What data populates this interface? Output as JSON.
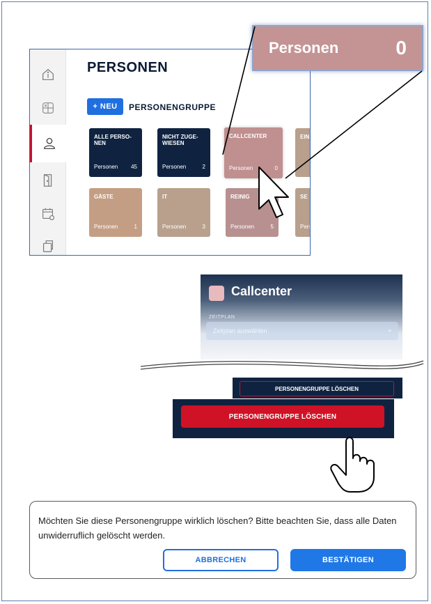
{
  "app": {
    "title": "PERSONEN",
    "new_button": "+ NEU",
    "group_label": "PERSONENGRUPPE",
    "sidebar": [
      {
        "icon": "info-icon"
      },
      {
        "icon": "calculator-icon"
      },
      {
        "icon": "user-icon",
        "active": true
      },
      {
        "icon": "door-icon"
      },
      {
        "icon": "calendar-icon"
      },
      {
        "icon": "copy-icon"
      }
    ],
    "tiles_row1": [
      {
        "name": "ALLE PERSO-\nNEN",
        "foot_label": "Personen",
        "count": "45"
      },
      {
        "name": "NICHT ZUGE-\nWIESEN",
        "foot_label": "Personen",
        "count": "2"
      },
      {
        "name": "CALLCENTER",
        "foot_label": "Personen",
        "count": "0"
      },
      {
        "name": "EIN",
        "foot_label": "",
        "count": ""
      }
    ],
    "tiles_row2": [
      {
        "name": "GÄSTE",
        "foot_label": "Personen",
        "count": "1"
      },
      {
        "name": "IT",
        "foot_label": "Personen",
        "count": "3"
      },
      {
        "name": "REINIG",
        "foot_label": "Personen",
        "count": "5"
      },
      {
        "name": "SE",
        "foot_label": "Pers",
        "count": ""
      }
    ]
  },
  "zoom": {
    "label": "Personen",
    "count": "0"
  },
  "callcenter": {
    "title": "Callcenter",
    "schedule_label": "ZEITPLAN",
    "schedule_placeholder": "Zeitplan auswählen"
  },
  "delete": {
    "small_label": "PERSONENGRUPPE LÖSCHEN",
    "big_label": "PERSONENGRUPPE LÖSCHEN"
  },
  "dialog": {
    "message": "Möchten Sie diese Personengruppe wirklich löschen? Bitte beachten Sie, dass alle Daten unwiderruflich gelöscht werden.",
    "cancel": "ABBRECHEN",
    "confirm": "BESTÄTIGEN"
  },
  "colors": {
    "navy": "#0f2341",
    "red": "#d01226",
    "blue": "#1f6fe0",
    "pink_tile": "#c08f8f"
  }
}
